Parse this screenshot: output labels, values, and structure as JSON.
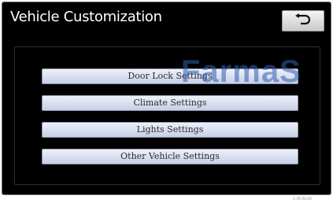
{
  "header": {
    "title": "Vehicle Customization",
    "back_icon": "return-arrow-icon"
  },
  "menu": {
    "items": [
      {
        "label": "Door Lock Settings"
      },
      {
        "label": "Climate Settings"
      },
      {
        "label": "Lights Settings"
      },
      {
        "label": "Other Vehicle Settings"
      }
    ]
  },
  "watermark": "FarmaS",
  "figure_code": "1-8C8L56",
  "colors": {
    "screen_bg": "#000000",
    "button_bg": "#dfe4f3",
    "watermark": "#2e5fb0"
  }
}
